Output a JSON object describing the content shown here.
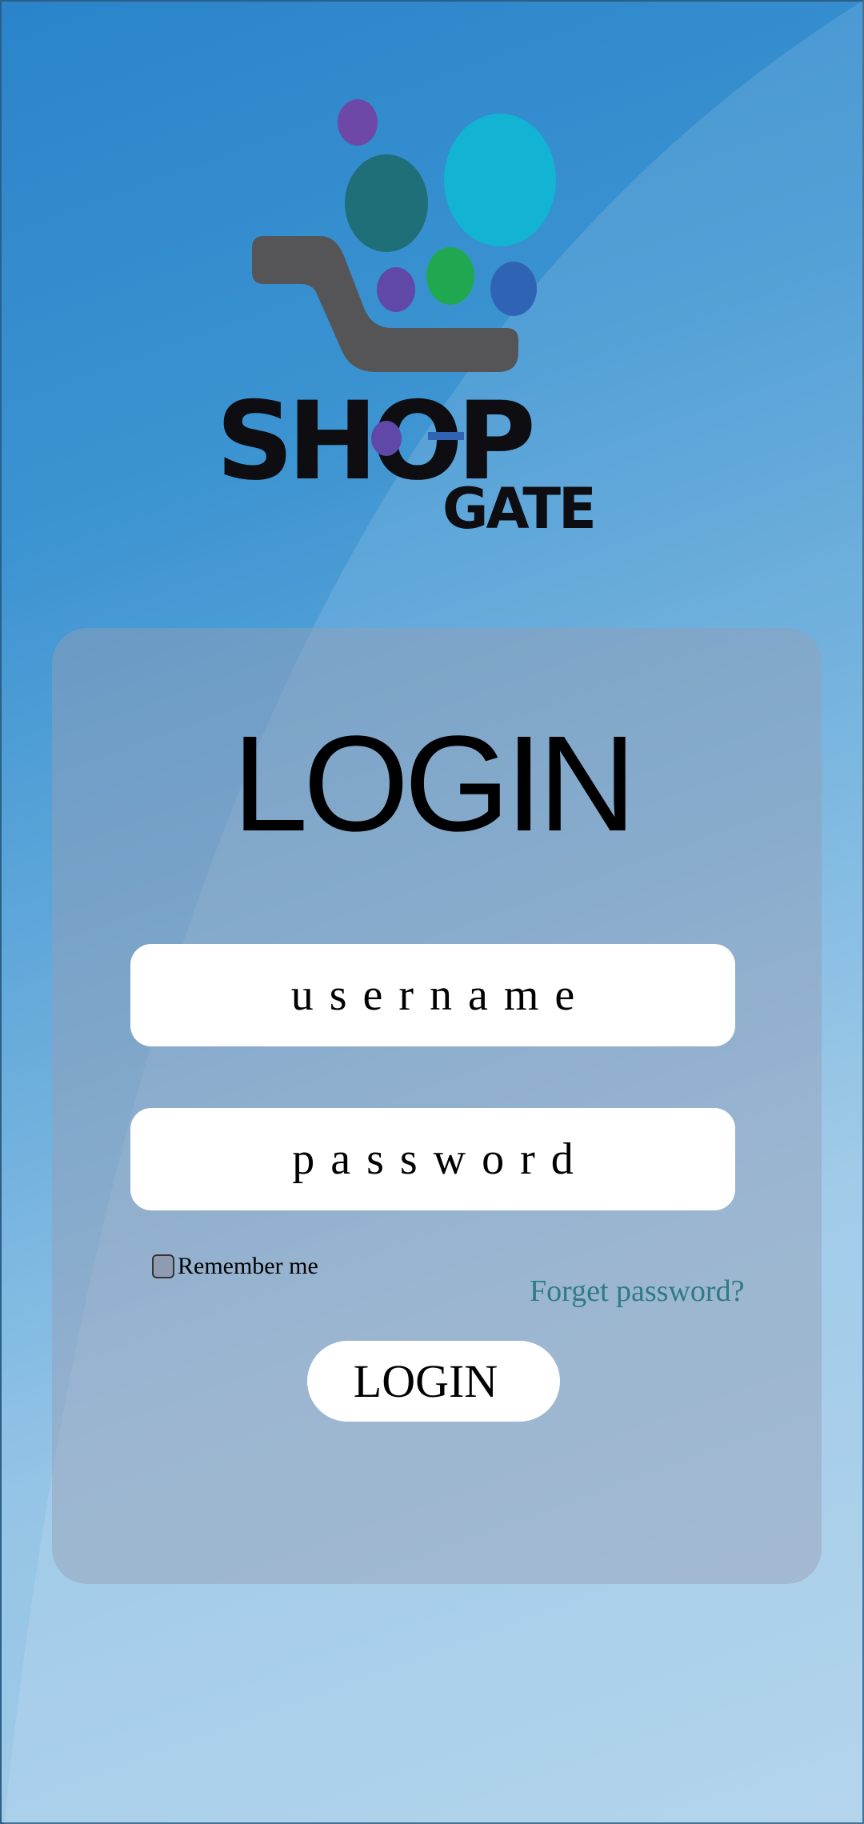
{
  "app": {
    "logo_text_primary": "SHOP",
    "logo_text_secondary": "GATE"
  },
  "login_card": {
    "title": "LOGIN",
    "username_placeholder": "username",
    "password_placeholder": "password",
    "remember_label": "Remember me",
    "forgot_label": "Forget password?",
    "submit_label": "LOGIN"
  },
  "colors": {
    "background_top": "#2a84c9",
    "background_bottom": "#aacfea",
    "forgot_link": "#2e7b86",
    "logo_cart": "#555558",
    "logo_dark_text": "#0d0d12"
  },
  "icons": {
    "logo": "shopping-cart-with-bubbles-icon",
    "checkbox": "checkbox-unchecked-icon"
  }
}
